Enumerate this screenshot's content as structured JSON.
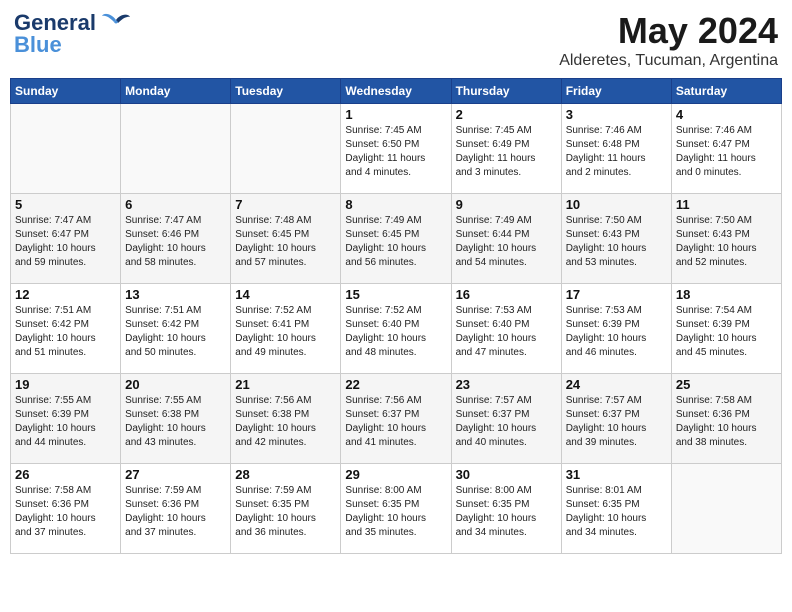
{
  "header": {
    "logo_general": "General",
    "logo_blue": "Blue",
    "month_title": "May 2024",
    "location": "Alderetes, Tucuman, Argentina"
  },
  "calendar": {
    "days_of_week": [
      "Sunday",
      "Monday",
      "Tuesday",
      "Wednesday",
      "Thursday",
      "Friday",
      "Saturday"
    ],
    "weeks": [
      [
        {
          "day": "",
          "info": ""
        },
        {
          "day": "",
          "info": ""
        },
        {
          "day": "",
          "info": ""
        },
        {
          "day": "1",
          "info": "Sunrise: 7:45 AM\nSunset: 6:50 PM\nDaylight: 11 hours\nand 4 minutes."
        },
        {
          "day": "2",
          "info": "Sunrise: 7:45 AM\nSunset: 6:49 PM\nDaylight: 11 hours\nand 3 minutes."
        },
        {
          "day": "3",
          "info": "Sunrise: 7:46 AM\nSunset: 6:48 PM\nDaylight: 11 hours\nand 2 minutes."
        },
        {
          "day": "4",
          "info": "Sunrise: 7:46 AM\nSunset: 6:47 PM\nDaylight: 11 hours\nand 0 minutes."
        }
      ],
      [
        {
          "day": "5",
          "info": "Sunrise: 7:47 AM\nSunset: 6:47 PM\nDaylight: 10 hours\nand 59 minutes."
        },
        {
          "day": "6",
          "info": "Sunrise: 7:47 AM\nSunset: 6:46 PM\nDaylight: 10 hours\nand 58 minutes."
        },
        {
          "day": "7",
          "info": "Sunrise: 7:48 AM\nSunset: 6:45 PM\nDaylight: 10 hours\nand 57 minutes."
        },
        {
          "day": "8",
          "info": "Sunrise: 7:49 AM\nSunset: 6:45 PM\nDaylight: 10 hours\nand 56 minutes."
        },
        {
          "day": "9",
          "info": "Sunrise: 7:49 AM\nSunset: 6:44 PM\nDaylight: 10 hours\nand 54 minutes."
        },
        {
          "day": "10",
          "info": "Sunrise: 7:50 AM\nSunset: 6:43 PM\nDaylight: 10 hours\nand 53 minutes."
        },
        {
          "day": "11",
          "info": "Sunrise: 7:50 AM\nSunset: 6:43 PM\nDaylight: 10 hours\nand 52 minutes."
        }
      ],
      [
        {
          "day": "12",
          "info": "Sunrise: 7:51 AM\nSunset: 6:42 PM\nDaylight: 10 hours\nand 51 minutes."
        },
        {
          "day": "13",
          "info": "Sunrise: 7:51 AM\nSunset: 6:42 PM\nDaylight: 10 hours\nand 50 minutes."
        },
        {
          "day": "14",
          "info": "Sunrise: 7:52 AM\nSunset: 6:41 PM\nDaylight: 10 hours\nand 49 minutes."
        },
        {
          "day": "15",
          "info": "Sunrise: 7:52 AM\nSunset: 6:40 PM\nDaylight: 10 hours\nand 48 minutes."
        },
        {
          "day": "16",
          "info": "Sunrise: 7:53 AM\nSunset: 6:40 PM\nDaylight: 10 hours\nand 47 minutes."
        },
        {
          "day": "17",
          "info": "Sunrise: 7:53 AM\nSunset: 6:39 PM\nDaylight: 10 hours\nand 46 minutes."
        },
        {
          "day": "18",
          "info": "Sunrise: 7:54 AM\nSunset: 6:39 PM\nDaylight: 10 hours\nand 45 minutes."
        }
      ],
      [
        {
          "day": "19",
          "info": "Sunrise: 7:55 AM\nSunset: 6:39 PM\nDaylight: 10 hours\nand 44 minutes."
        },
        {
          "day": "20",
          "info": "Sunrise: 7:55 AM\nSunset: 6:38 PM\nDaylight: 10 hours\nand 43 minutes."
        },
        {
          "day": "21",
          "info": "Sunrise: 7:56 AM\nSunset: 6:38 PM\nDaylight: 10 hours\nand 42 minutes."
        },
        {
          "day": "22",
          "info": "Sunrise: 7:56 AM\nSunset: 6:37 PM\nDaylight: 10 hours\nand 41 minutes."
        },
        {
          "day": "23",
          "info": "Sunrise: 7:57 AM\nSunset: 6:37 PM\nDaylight: 10 hours\nand 40 minutes."
        },
        {
          "day": "24",
          "info": "Sunrise: 7:57 AM\nSunset: 6:37 PM\nDaylight: 10 hours\nand 39 minutes."
        },
        {
          "day": "25",
          "info": "Sunrise: 7:58 AM\nSunset: 6:36 PM\nDaylight: 10 hours\nand 38 minutes."
        }
      ],
      [
        {
          "day": "26",
          "info": "Sunrise: 7:58 AM\nSunset: 6:36 PM\nDaylight: 10 hours\nand 37 minutes."
        },
        {
          "day": "27",
          "info": "Sunrise: 7:59 AM\nSunset: 6:36 PM\nDaylight: 10 hours\nand 37 minutes."
        },
        {
          "day": "28",
          "info": "Sunrise: 7:59 AM\nSunset: 6:35 PM\nDaylight: 10 hours\nand 36 minutes."
        },
        {
          "day": "29",
          "info": "Sunrise: 8:00 AM\nSunset: 6:35 PM\nDaylight: 10 hours\nand 35 minutes."
        },
        {
          "day": "30",
          "info": "Sunrise: 8:00 AM\nSunset: 6:35 PM\nDaylight: 10 hours\nand 34 minutes."
        },
        {
          "day": "31",
          "info": "Sunrise: 8:01 AM\nSunset: 6:35 PM\nDaylight: 10 hours\nand 34 minutes."
        },
        {
          "day": "",
          "info": ""
        }
      ]
    ]
  }
}
